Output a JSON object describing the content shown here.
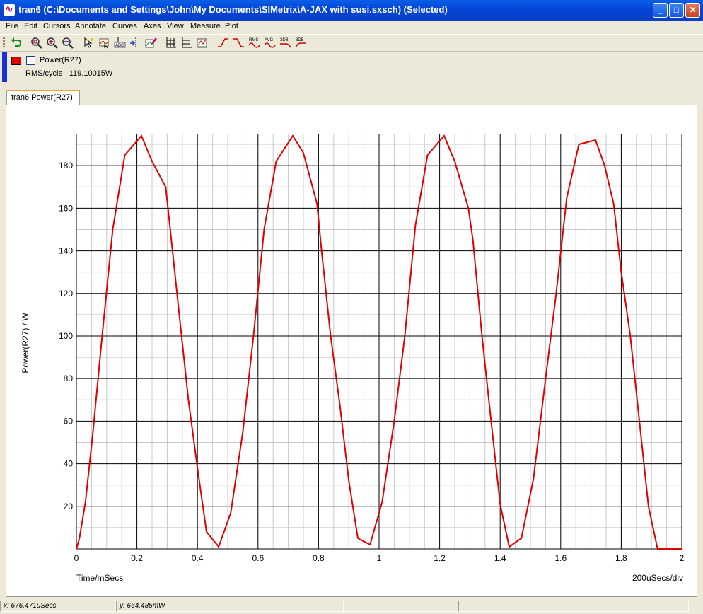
{
  "window": {
    "title": "tran6 (C:\\Documents and Settings\\John\\My Documents\\SIMetrix\\A-JAX with susi.sxsch) (Selected)"
  },
  "menu": [
    "File",
    "Edit",
    "Cursors",
    "Annotate",
    "Curves",
    "Axes",
    "View",
    "Measure",
    "Plot"
  ],
  "toolbar": {
    "rms_label": "RMS",
    "avg_label": "AVG",
    "db3_label": "3DB",
    "db3b_label": "3DB"
  },
  "legend": {
    "curve_name": "Power(R27)",
    "measure_label": "RMS/cycle",
    "measure_value": "119.10015W",
    "curve_color": "#e00000"
  },
  "tab": {
    "label": "tran6 Power(R27)"
  },
  "status": {
    "x_readout": "x: 676.471uSecs",
    "y_readout": "y: 664.485mW"
  },
  "chart_data": {
    "type": "line",
    "ylabel": "Power(R27) / W",
    "xlabel": "Time/mSecs",
    "x_division_label": "200uSecs/div",
    "xlim": [
      0,
      2
    ],
    "ylim": [
      0,
      195
    ],
    "x_ticks": [
      "0",
      "0.2",
      "0.4",
      "0.6",
      "0.8",
      "1",
      "1.2",
      "1.4",
      "1.6",
      "1.8",
      "2"
    ],
    "y_ticks": [
      "20",
      "40",
      "60",
      "80",
      "100",
      "120",
      "140",
      "160",
      "180"
    ],
    "grid": true,
    "series": [
      {
        "color": "#e00000",
        "x": [
          0,
          0.01,
          0.03,
          0.055,
          0.085,
          0.12,
          0.16,
          0.215,
          0.25,
          0.295,
          0.31,
          0.34,
          0.37,
          0.4,
          0.43,
          0.47,
          0.51,
          0.55,
          0.585,
          0.62,
          0.66,
          0.715,
          0.75,
          0.795,
          0.81,
          0.84,
          0.87,
          0.9,
          0.93,
          0.97,
          1.01,
          1.05,
          1.085,
          1.12,
          1.16,
          1.215,
          1.25,
          1.295,
          1.31,
          1.34,
          1.37,
          1.4,
          1.43,
          1.47,
          1.51,
          1.55,
          1.585,
          1.62,
          1.66,
          1.715,
          1.745,
          1.775,
          1.8,
          1.83,
          1.86,
          1.89,
          1.92,
          1.95,
          1.99,
          2.0
        ],
        "values": [
          0,
          5,
          22,
          55,
          100,
          150,
          185,
          194,
          182,
          170,
          150,
          110,
          70,
          38,
          8,
          1,
          17,
          55,
          100,
          150,
          182,
          194,
          186,
          162,
          140,
          100,
          68,
          32,
          5,
          2,
          22,
          60,
          100,
          152,
          185,
          194,
          182,
          160,
          145,
          100,
          60,
          21,
          1,
          5,
          33,
          80,
          120,
          165,
          190,
          192,
          180,
          162,
          130,
          100,
          60,
          20,
          0,
          0,
          0,
          0
        ]
      }
    ]
  }
}
